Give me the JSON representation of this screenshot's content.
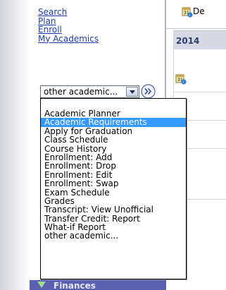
{
  "nav": {
    "links": [
      "Search",
      "Plan",
      "Enroll",
      "My Academics"
    ]
  },
  "select": {
    "value": "other academic...",
    "options": [
      "Academic Planner",
      "Academic Requirements",
      "Apply for Graduation",
      "Class Schedule",
      "Course History",
      "Enrollment: Add",
      "Enrollment: Drop",
      "Enrollment: Edit",
      "Enrollment: Swap",
      "Exam Schedule",
      "Grades",
      "Transcript: View Unofficial",
      "Transfer Credit: Report",
      "What-if Report",
      "other academic..."
    ],
    "highlighted": "Academic Requirements"
  },
  "section": {
    "finances": "Finances"
  },
  "content": {
    "doc_label": "De",
    "year_header": "2014"
  },
  "icons": {
    "go_button": "double-chevron-right-icon",
    "row_icon": "calendar-info-icon",
    "section_icon": "triangle-down-icon"
  },
  "colors": {
    "link": "#1a3cb0",
    "highlight": "#3399ff",
    "section_bar": "#5b5fb0"
  }
}
